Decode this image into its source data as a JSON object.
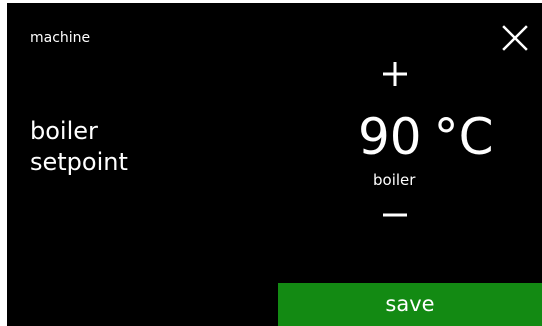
{
  "header": {
    "breadcrumb": "machine",
    "close_icon": "close-icon"
  },
  "setting": {
    "label_line1": "boiler",
    "label_line2": "setpoint"
  },
  "value": {
    "number": "90",
    "unit": "°C",
    "sub_label": "boiler"
  },
  "controls": {
    "increment_icon": "plus-icon",
    "decrement_icon": "minus-icon"
  },
  "footer": {
    "save_label": "save"
  },
  "colors": {
    "background": "#000000",
    "text": "#ffffff",
    "save_button": "#138a13"
  }
}
